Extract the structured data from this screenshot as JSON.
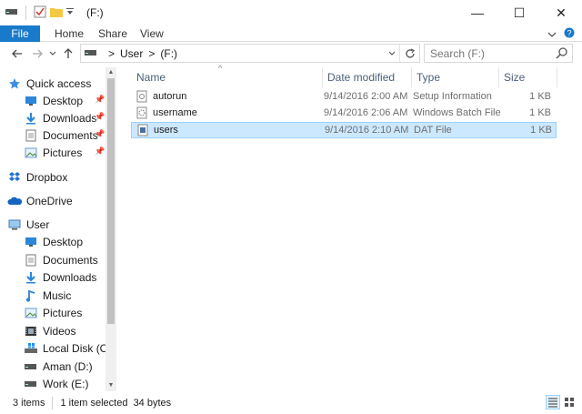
{
  "window": {
    "title": "(F:)",
    "minimize": "—",
    "maximize": "☐",
    "close": "✕"
  },
  "ribbon": {
    "tabs": [
      "File",
      "Home",
      "Share",
      "View"
    ]
  },
  "address": {
    "crumbs": [
      "User",
      "(F:)"
    ]
  },
  "search": {
    "placeholder": "Search (F:)"
  },
  "nav": {
    "quick_access": "Quick access",
    "quick_items": [
      "Desktop",
      "Downloads",
      "Documents",
      "Pictures"
    ],
    "dropbox": "Dropbox",
    "onedrive": "OneDrive",
    "user": "User",
    "user_items": [
      "Desktop",
      "Documents",
      "Downloads",
      "Music",
      "Pictures",
      "Videos",
      "Local Disk (C:)",
      "Aman (D:)",
      "Work (E:)"
    ]
  },
  "columns": [
    "Name",
    "Date modified",
    "Type",
    "Size"
  ],
  "files": [
    {
      "name": "autorun",
      "date": "9/14/2016 2:00 AM",
      "type": "Setup Information",
      "size": "1 KB"
    },
    {
      "name": "username",
      "date": "9/14/2016 2:06 AM",
      "type": "Windows Batch File",
      "size": "1 KB"
    },
    {
      "name": "users",
      "date": "9/14/2016 2:10 AM",
      "type": "DAT File",
      "size": "1 KB"
    }
  ],
  "status": {
    "count": "3 items",
    "selection": "1 item selected  34 bytes"
  },
  "colors": {
    "accent": "#1979ca",
    "selection": "#cce8ff",
    "selection_border": "#99d1ff"
  }
}
